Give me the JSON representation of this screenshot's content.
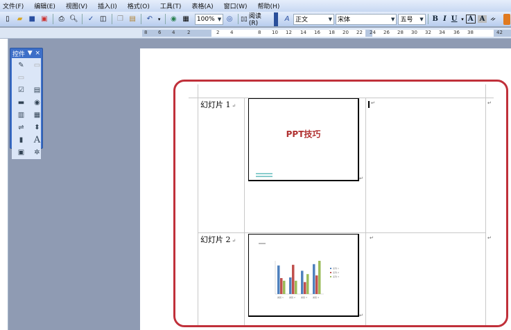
{
  "menu": [
    "文件(F)",
    "编辑(E)",
    "视图(V)",
    "插入(I)",
    "格式(O)",
    "工具(T)",
    "表格(A)",
    "窗口(W)",
    "帮助(H)"
  ],
  "toolbar": {
    "zoom": "100%",
    "read_label": "阅读(R)",
    "style": "正文",
    "font": "宋体",
    "size": "五号",
    "bold": "B",
    "italic": "I",
    "underline": "U",
    "char_border": "A",
    "char_shading": "A"
  },
  "ruler": {
    "left_ticks": [
      "8",
      "6",
      "4",
      "2"
    ],
    "right_ticks": [
      "2",
      "4",
      "8",
      "10",
      "12",
      "14",
      "16",
      "18",
      "20",
      "22",
      "24",
      "26",
      "28",
      "30",
      "32",
      "34",
      "36",
      "38",
      "42"
    ]
  },
  "palette": {
    "title": "控件",
    "close": "×",
    "label_tool": "A"
  },
  "table": {
    "rows": [
      {
        "label": "幻灯片 1"
      },
      {
        "label": "幻灯片 2"
      }
    ]
  },
  "slide1": {
    "title": "PPT技巧",
    "title_color": "#b03030"
  },
  "slide2": {
    "chart": {
      "type": "bar",
      "categories": [
        "类别 1",
        "类别 2",
        "类别 3",
        "类别 4"
      ],
      "series": [
        {
          "name": "系列 1",
          "color": "#4f81bd",
          "values": [
            4.3,
            2.5,
            3.5,
            4.5
          ]
        },
        {
          "name": "系列 2",
          "color": "#c0504d",
          "values": [
            2.4,
            4.4,
            1.8,
            2.8
          ]
        },
        {
          "name": "系列 3",
          "color": "#9bbb59",
          "values": [
            2,
            2,
            3,
            5
          ]
        }
      ],
      "ylim": [
        0,
        5
      ]
    }
  }
}
